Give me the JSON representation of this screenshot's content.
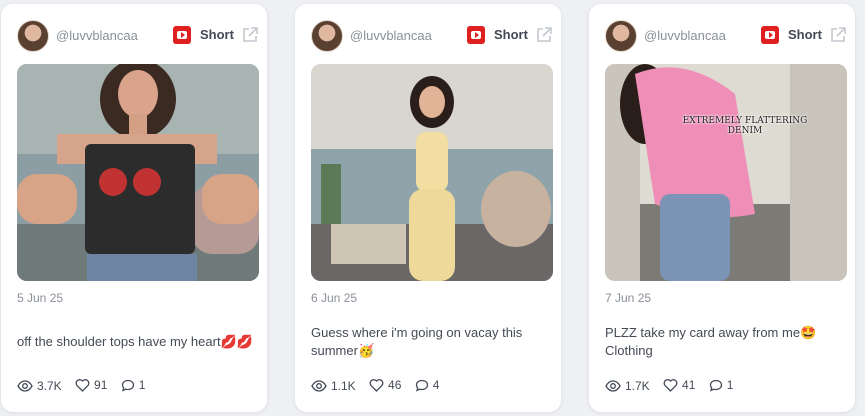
{
  "posts": [
    {
      "username": "@luvvblancaa",
      "badge_label": "Short",
      "date": "5 Jun 25",
      "caption": "off the shoulder tops have my heart💋💋",
      "views": "3.7K",
      "likes": "91",
      "comments": "1"
    },
    {
      "username": "@luvvblancaa",
      "badge_label": "Short",
      "date": "6 Jun 25",
      "caption": "Guess where i'm going on vacay this summer🥳",
      "views": "1.1K",
      "likes": "46",
      "comments": "4"
    },
    {
      "username": "@luvvblancaa",
      "badge_label": "Short",
      "date": "7 Jun 25",
      "caption": "PLZZ take my card away from me🤩 Clothing",
      "views": "1.7K",
      "likes": "41",
      "comments": "1",
      "overlay_text": "EXTREMELY FLATTERING DENIM"
    }
  ],
  "icons": {
    "platform": "youtube-icon",
    "external": "external-link-icon",
    "views": "eye-icon",
    "likes": "heart-icon",
    "comments": "comment-icon"
  },
  "colors": {
    "badge": "#e02020",
    "text": "#444a55",
    "muted": "#8a8f99"
  }
}
